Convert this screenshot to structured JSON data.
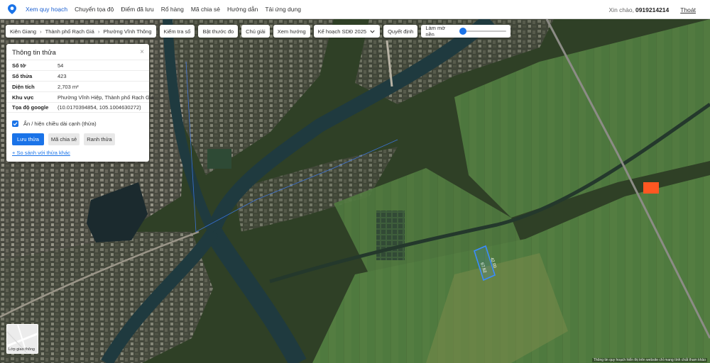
{
  "nav": {
    "items": [
      "Xem quy hoạch",
      "Chuyển tọa độ",
      "Điểm đã lưu",
      "Rổ hàng",
      "Mã chia sẻ",
      "Hướng dẫn",
      "Tải ứng dụng"
    ],
    "greeting": "Xin chào,",
    "phone": "0919214214",
    "logout": "Thoát"
  },
  "breadcrumb": [
    "Kiên Giang",
    "Thành phố Rạch Giá",
    "Phường Vĩnh Thông"
  ],
  "toolbar": {
    "check_size": "Kiểm tra sổ",
    "ruler": "Bật thước đo",
    "legend": "Chú giải",
    "direction": "Xem hướng",
    "plan": "Kế hoạch SDĐ 2025",
    "decision": "Quyết định",
    "opacity_label": "Làm mờ nền",
    "opacity_value": 0.05
  },
  "panel": {
    "title": "Thông tin thửa",
    "close": "×",
    "rows": [
      {
        "key": "Số tờ",
        "value": "54"
      },
      {
        "key": "Số thửa",
        "value": "423"
      },
      {
        "key": "Diện tích",
        "value": "2,703 m²"
      },
      {
        "key": "Khu vực",
        "value": "Phường Vĩnh Hiệp, Thành phố Rạch Giá"
      },
      {
        "key": "Tọa độ google",
        "value": "(10.0170394854, 105.1004630272)"
      }
    ],
    "checkbox_label": "Ẩn / hiện chiều dài cạnh (thửa)",
    "checkbox_checked": true,
    "buttons": {
      "save": "Lưu thửa",
      "share": "Mã chia sẻ",
      "boundary": "Ranh thửa"
    },
    "compare_link": "+ So sánh với thửa khác"
  },
  "parcel_labels": [
    "42.00",
    "67.62"
  ],
  "layer_button": "Lớp giao thông",
  "attribution": "Thông tin quy hoạch hiển thị trên website chỉ mang tính chất tham khảo",
  "colors": {
    "accent": "#1a73e8",
    "parcel_outline": "#3b8cff",
    "marker": "#ff5722"
  }
}
